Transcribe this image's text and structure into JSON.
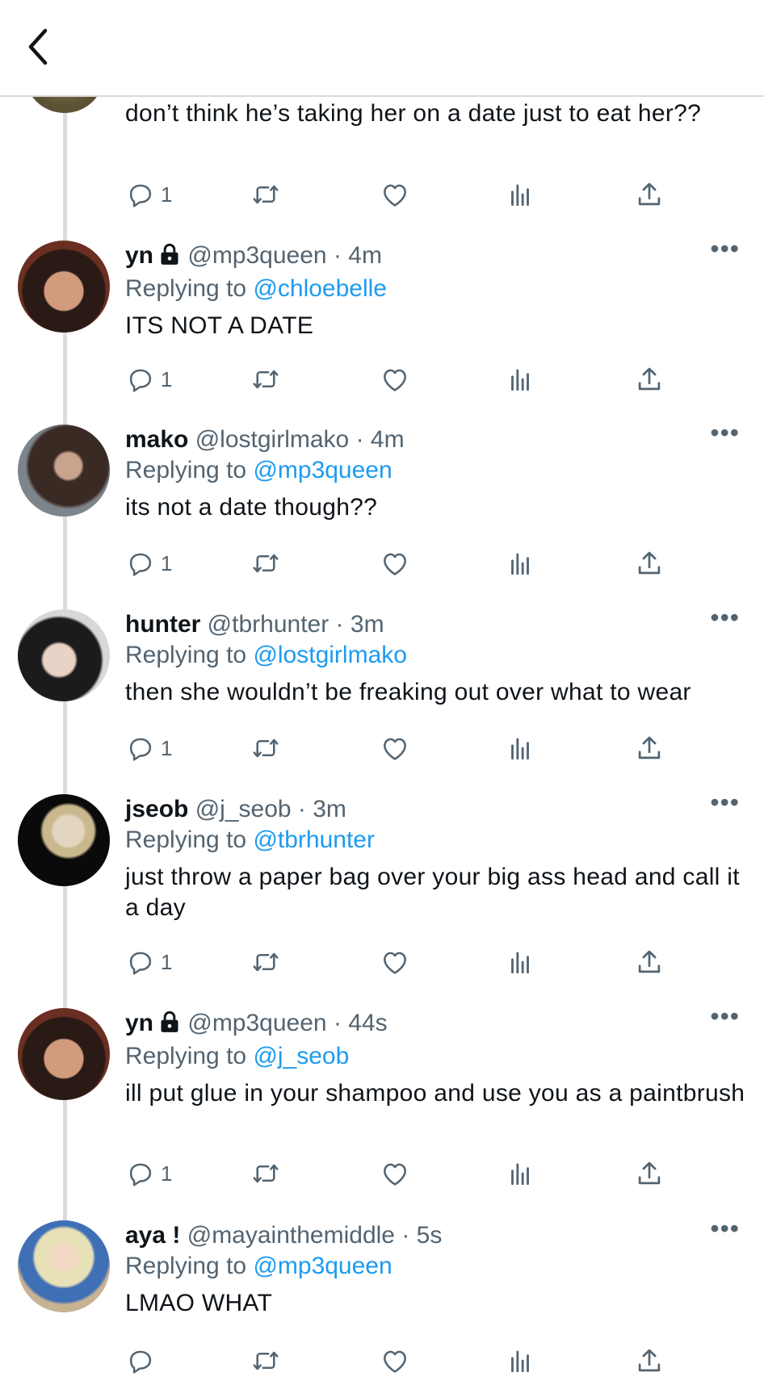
{
  "header": {
    "back_label": "Back"
  },
  "top_tweet": {
    "text": "don’t think he’s taking her on a date just to eat her??",
    "reply_count": "1"
  },
  "tweets": [
    {
      "name": "yn",
      "locked": true,
      "handle": "@mp3queen",
      "time": "4m",
      "reply_prefix": "Replying to",
      "reply_to": "@chloebelle",
      "text": "ITS NOT A DATE",
      "reply_count": "1"
    },
    {
      "name": "mako",
      "locked": false,
      "handle": "@lostgirlmako",
      "time": "4m",
      "reply_prefix": "Replying to",
      "reply_to": "@mp3queen",
      "text": "its not a date though??",
      "reply_count": "1"
    },
    {
      "name": "hunter",
      "locked": false,
      "handle": "@tbrhunter",
      "time": "3m",
      "reply_prefix": "Replying to",
      "reply_to": "@lostgirlmako",
      "text": "then she wouldn’t be freaking out over what to wear",
      "reply_count": "1"
    },
    {
      "name": "jseob",
      "locked": false,
      "handle": "@j_seob",
      "time": "3m",
      "reply_prefix": "Replying to",
      "reply_to": "@tbrhunter",
      "text": "just throw a paper bag over your big ass head and call it a day",
      "reply_count": "1"
    },
    {
      "name": "yn",
      "locked": true,
      "handle": "@mp3queen",
      "time": "44s",
      "reply_prefix": "Replying to",
      "reply_to": "@j_seob",
      "text": "ill put glue in your shampoo and use you as a paintbrush",
      "reply_count": "1"
    },
    {
      "name": "aya !",
      "locked": false,
      "handle": "@mayainthemiddle",
      "time": "5s",
      "reply_prefix": "Replying to",
      "reply_to": "@mp3queen",
      "text": "LMAO WHAT",
      "reply_count": ""
    }
  ],
  "icons": {
    "reply": "reply-icon",
    "retweet": "retweet-icon",
    "like": "like-icon",
    "analytics": "analytics-icon",
    "share": "share-icon",
    "more": "more-icon",
    "lock": "lock-icon",
    "back": "back-arrow-icon"
  },
  "colors": {
    "link": "#1d9bf0",
    "secondary_text": "#536471",
    "primary_text": "#0f1419"
  },
  "more_glyph": "•••",
  "meta_separator": "·"
}
